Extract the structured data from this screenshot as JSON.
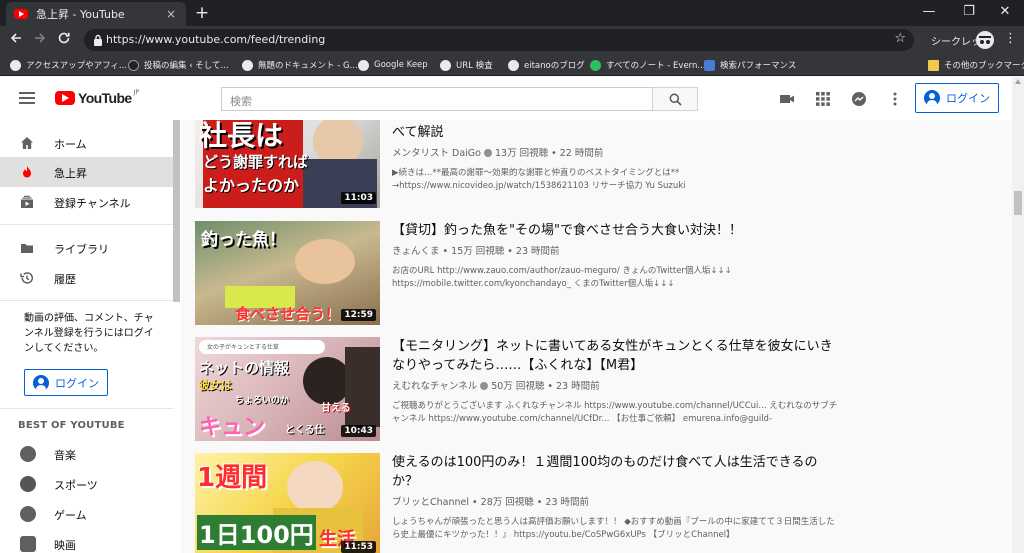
{
  "browser": {
    "tab_title": "急上昇 - YouTube",
    "tab_close": "×",
    "new_tab": "+",
    "url": "https://www.youtube.com/feed/trending",
    "incognito_label": "シークレット",
    "window_controls": [
      "—",
      "❐",
      "✕"
    ]
  },
  "bookmarks": [
    {
      "label": "アクセスアップやアフィ...",
      "icon_color": "#e8eaed"
    },
    {
      "label": "投稿の編集 ‹ そして...",
      "icon_color": "#202124"
    },
    {
      "label": "無題のドキュメント - G...",
      "icon_color": "#e8eaed"
    },
    {
      "label": "Google Keep",
      "icon_color": "#e8eaed"
    },
    {
      "label": "URL 検査",
      "icon_color": "#e8eaed"
    },
    {
      "label": "eitanoのブログ",
      "icon_color": "#e8eaed"
    },
    {
      "label": "すべてのノート - Evern...",
      "icon_color": "#2dbe60"
    },
    {
      "label": "検索パフォーマンス",
      "icon_color": "#4a7bd0"
    }
  ],
  "bookmarks_other": "その他のブックマーク",
  "header": {
    "brand": "YouTube",
    "region": "JP",
    "search_placeholder": "検索",
    "login_label": "ログイン"
  },
  "sidebar": {
    "items": [
      {
        "label": "ホーム",
        "icon": "home-icon"
      },
      {
        "label": "急上昇",
        "icon": "trending-fire-icon"
      },
      {
        "label": "登録チャンネル",
        "icon": "subscriptions-icon"
      },
      {
        "label": "ライブラリ",
        "icon": "library-folder-icon"
      },
      {
        "label": "履歴",
        "icon": "history-icon"
      }
    ],
    "login_prompt": "動画の評価、コメント、チャンネル登録を行うにはログインしてください。",
    "login_label": "ログイン",
    "section_title": "BEST OF YOUTUBE",
    "best_items": [
      {
        "label": "音楽",
        "icon": "music-icon"
      },
      {
        "label": "スポーツ",
        "icon": "sports-icon"
      },
      {
        "label": "ゲーム",
        "icon": "game-icon"
      },
      {
        "label": "映画",
        "icon": "movie-icon"
      }
    ]
  },
  "videos": [
    {
      "title": "のどうしているんでしょうか【謝罪のうまい下手】のうまい謝罪の謝罪を比べて解説",
      "channel": "メンタリスト DaiGo",
      "verified": true,
      "stats": "13万 回視聴 • 22 時間前",
      "description": "▶続きは…**最高の謝罪〜効果的な謝罪と仲直りのベストタイミングとは** →https://www.nicovideo.jp/watch/1538621103 リサーチ協力 Yu Suzuki",
      "duration": "11:03",
      "thumb_text": [
        "社長は",
        "どう謝罪すれば",
        "よかったのか"
      ]
    },
    {
      "title": "【貸切】釣った魚を\"その場\"で食べさせ合う大食い対決！！",
      "channel": "きょんくま",
      "verified": false,
      "stats": "15万 回視聴 • 23 時間前",
      "description": "お店のURL http://www.zauo.com/author/zauo-meguro/ きょんのTwitter個人垢↓↓↓ https://mobile.twitter.com/kyonchandayo_ くまのTwitter個人垢↓↓↓",
      "duration": "12:59",
      "thumb_text": [
        "釣った魚！",
        "食べさせ合う！"
      ]
    },
    {
      "title": "【モニタリング】ネットに書いてある女性がキュンとくる仕草を彼女にいきなりやってみたら……【ふくれな】【M君】",
      "channel": "えむれなチャンネル",
      "verified": true,
      "stats": "50万 回視聴 • 23 時間前",
      "description": "ご視聴ありがとうございます ふくれなチャンネル https://www.youtube.com/channel/UCCui... えむれなのサブチャンネル https://www.youtube.com/channel/UCfDr... 【お仕事ご依頼】 emurena.info@guild-",
      "duration": "10:43",
      "thumb_text": [
        "女の子がキュンとする仕草",
        "ネットの情報",
        "彼女は",
        "ちょろいのか",
        "甘える",
        "キュン",
        "とくる仕"
      ]
    },
    {
      "title": "使えるのは100円のみ！１週間100均のものだけ食べて人は生活できるのか？",
      "channel": "ブリッとChannel",
      "verified": false,
      "stats": "28万 回視聴 • 23 時間前",
      "description": "しょうちゃんが頑張ったと思う人は高評価お願いします！！ ◆おすすめ動画『プールの中に家建てて３日間生活したら史上最優にキツかった！！』 https://youtu.be/CoSPwG6xUPs 【ブリッとChannel】",
      "duration": "11:53",
      "thumb_text": [
        "1週間",
        "1日100円",
        "生活"
      ]
    }
  ]
}
